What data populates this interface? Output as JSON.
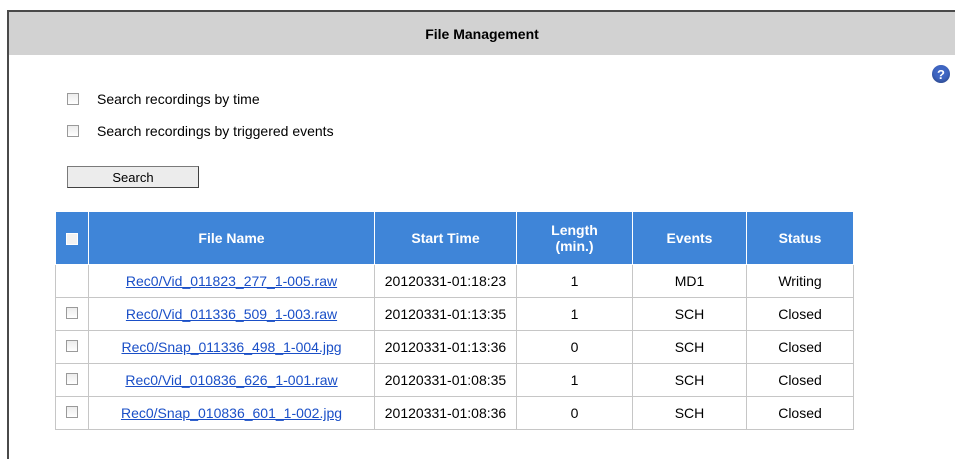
{
  "header": {
    "title": "File Management",
    "help_glyph": "?"
  },
  "search": {
    "option_time": "Search recordings by time",
    "option_events": "Search recordings by triggered events",
    "button_label": "Search"
  },
  "table": {
    "columns": [
      "File Name",
      "Start Time",
      "Length (min.)",
      "Events",
      "Status"
    ],
    "length_line1": "Length",
    "length_line2": "(min.)",
    "rows": [
      {
        "file": "Rec0/Vid_011823_277_1-005.raw",
        "start": "20120331-01:18:23",
        "length": "1",
        "events": "MD1",
        "status": "Writing"
      },
      {
        "file": "Rec0/Vid_011336_509_1-003.raw",
        "start": "20120331-01:13:35",
        "length": "1",
        "events": "SCH",
        "status": "Closed"
      },
      {
        "file": "Rec0/Snap_011336_498_1-004.jpg",
        "start": "20120331-01:13:36",
        "length": "0",
        "events": "SCH",
        "status": "Closed"
      },
      {
        "file": "Rec0/Vid_010836_626_1-001.raw",
        "start": "20120331-01:08:35",
        "length": "1",
        "events": "SCH",
        "status": "Closed"
      },
      {
        "file": "Rec0/Snap_010836_601_1-002.jpg",
        "start": "20120331-01:08:36",
        "length": "0",
        "events": "SCH",
        "status": "Closed"
      }
    ]
  },
  "colors": {
    "header_bg": "#d2d2d2",
    "table_header": "#3f85d8",
    "link": "#1a4fc7",
    "help_icon": "#3f66c3"
  }
}
